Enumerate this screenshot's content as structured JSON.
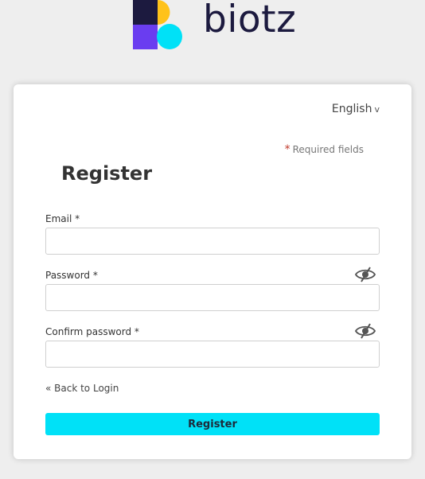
{
  "brand": {
    "name": "biotz",
    "colors": {
      "navy": "#1c1a3f",
      "yellow": "#ffc21a",
      "purple": "#6a3df0",
      "cyan": "#00e1f7"
    }
  },
  "language": {
    "selected": "English",
    "chevron": "v"
  },
  "required_note": {
    "star": "*",
    "text": "Required fields"
  },
  "form": {
    "title": "Register",
    "email": {
      "label": "Email *",
      "value": "",
      "placeholder": ""
    },
    "password": {
      "label": "Password *",
      "value": "",
      "placeholder": "",
      "toggle_icon": "eye-slash-icon"
    },
    "confirm_password": {
      "label": "Confirm password *",
      "value": "",
      "placeholder": "",
      "toggle_icon": "eye-slash-icon"
    },
    "back_link": "« Back to Login",
    "submit_label": "Register",
    "submit_color": "#00e1f7"
  }
}
